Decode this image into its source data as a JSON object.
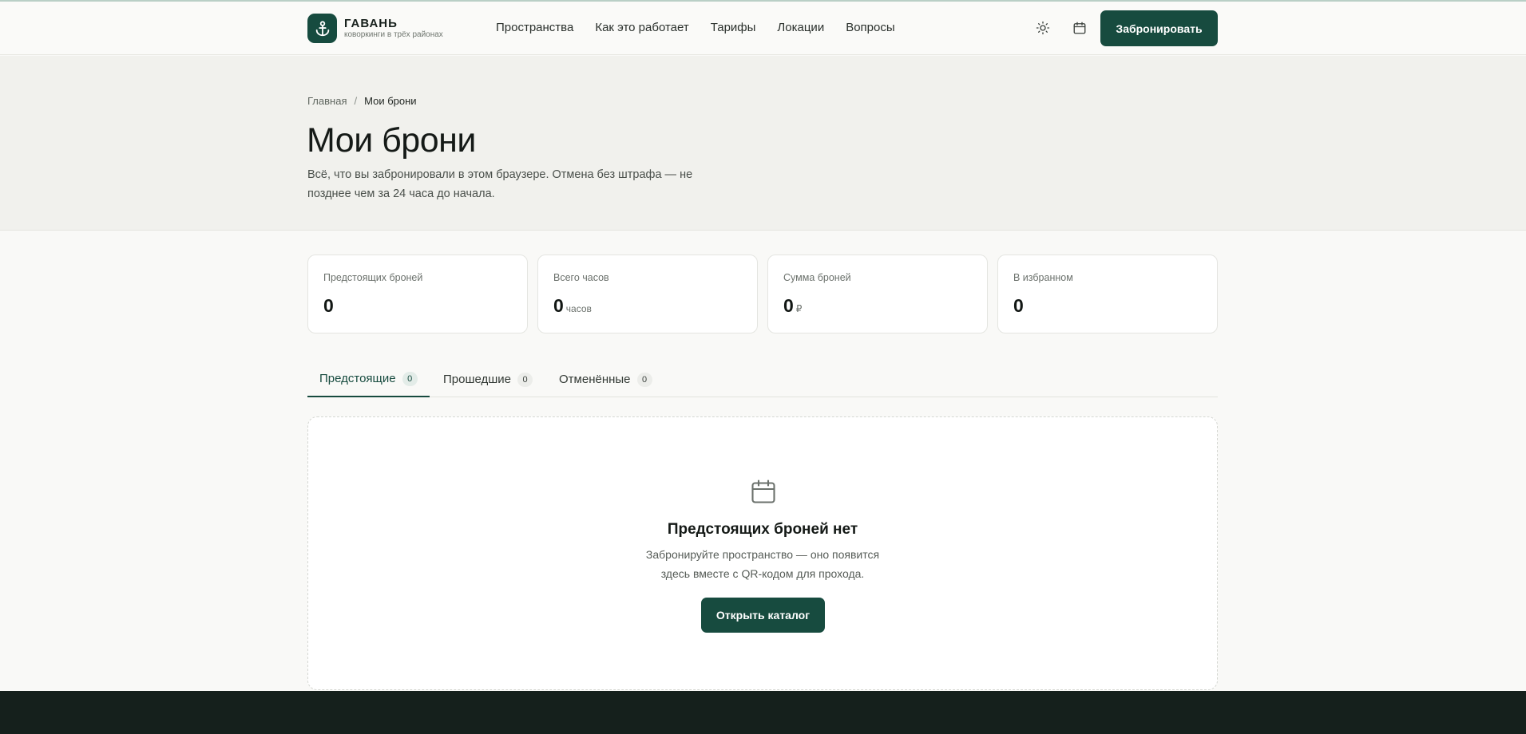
{
  "brand": {
    "name": "ГАВАНЬ",
    "tagline": "коворкинги в трёх районах",
    "accent": "#174b3f"
  },
  "nav": {
    "items": [
      {
        "label": "Пространства"
      },
      {
        "label": "Как это работает"
      },
      {
        "label": "Тарифы"
      },
      {
        "label": "Локации"
      },
      {
        "label": "Вопросы"
      }
    ],
    "icons": [
      "sun-icon",
      "calendar-icon"
    ],
    "book_label": "Забронировать"
  },
  "hero": {
    "breadcrumb_home": "Главная",
    "breadcrumb_sep": "/",
    "breadcrumb_current": "Мои брони",
    "title": "Мои брони",
    "subtitle": "Всё, что вы забронировали в этом браузере. Отмена без штрафа — не позднее чем за 24 часа до начала."
  },
  "stats": [
    {
      "label": "Предстоящих броней",
      "value": "0",
      "unit": ""
    },
    {
      "label": "Всего часов",
      "value": "0",
      "unit": "часов"
    },
    {
      "label": "Сумма броней",
      "value": "0",
      "unit": "₽"
    },
    {
      "label": "В избранном",
      "value": "0",
      "unit": ""
    }
  ],
  "tabs": [
    {
      "label": "Предстоящие",
      "count": "0",
      "active": true
    },
    {
      "label": "Прошедшие",
      "count": "0",
      "active": false
    },
    {
      "label": "Отменённые",
      "count": "0",
      "active": false
    }
  ],
  "empty_state": {
    "icon": "calendar-icon",
    "title": "Предстоящих броней нет",
    "text_line1": "Забронируйте пространство — оно появится",
    "text_line2": "здесь вместе с QR-кодом для прохода.",
    "button_label": "Открыть каталог"
  }
}
